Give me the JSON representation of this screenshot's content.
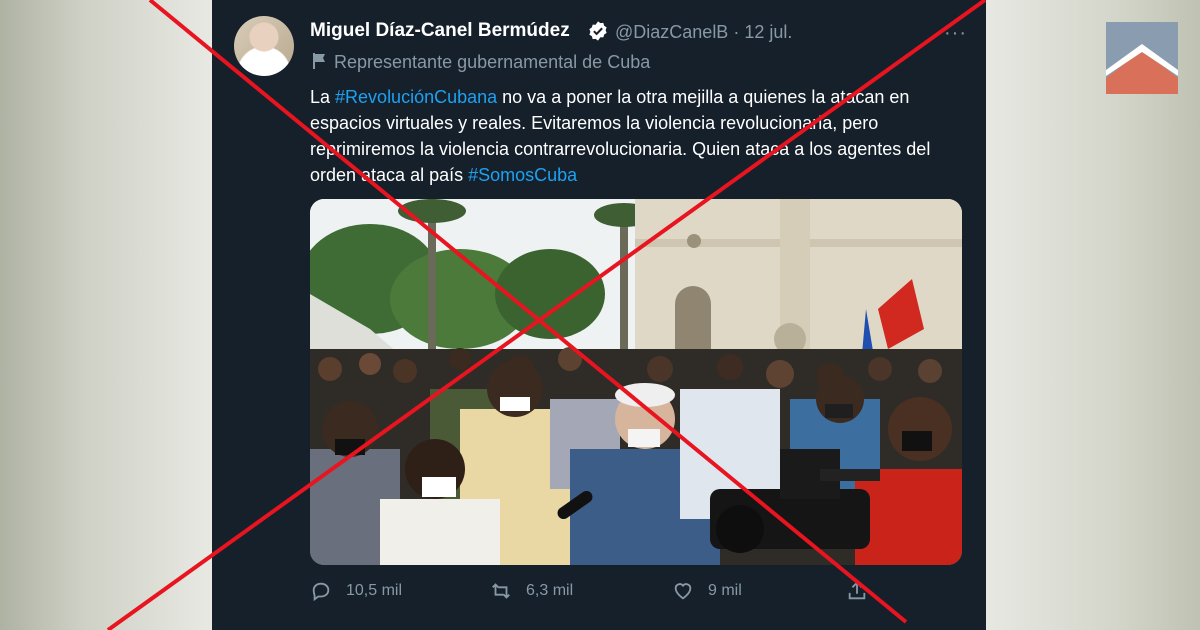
{
  "tweet": {
    "author_name": "Miguel Díaz-Canel Bermúdez",
    "handle_and_date": "@DiazCanelB · 12 jul.",
    "more_glyph": "···",
    "label": "Representante gubernamental de Cuba",
    "text_parts": [
      "La ",
      "#RevoluciónCubana",
      " no va a poner la otra mejilla a quienes la atacan en espacios virtuales y reales. Evitaremos la violencia revolucionaria, pero reprimiremos la violencia contrarrevolucionaria. Quien ataca a los agentes del orden ataca al país ",
      "#SomosCuba"
    ],
    "hashtag_color": "#1da1f2",
    "reply_count": "10,5 mil",
    "retweet_count": "6,3 mil",
    "like_count": "9 mil"
  },
  "icons": {
    "verified": "verified-badge-icon",
    "flag": "flag-icon",
    "reply": "reply-icon",
    "retweet": "retweet-icon",
    "like": "heart-icon",
    "share": "share-icon"
  },
  "colors": {
    "card_background": "#15202b",
    "cross": "#e8141f",
    "muted_text": "#8899a6"
  }
}
